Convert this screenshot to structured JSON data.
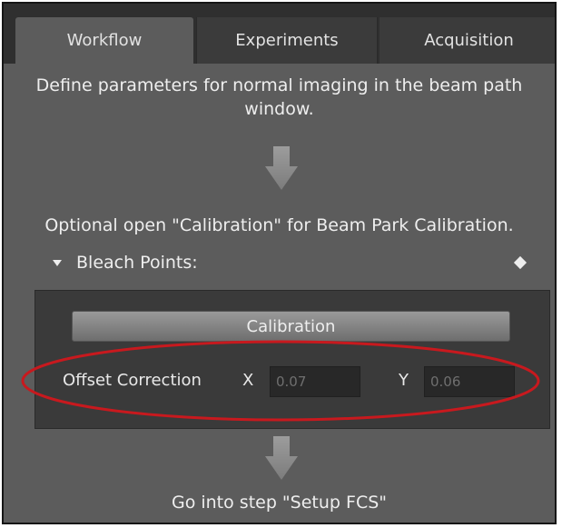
{
  "tabs": [
    {
      "label": "Workflow",
      "active": true
    },
    {
      "label": "Experiments",
      "active": false
    },
    {
      "label": "Acquisition",
      "active": false
    }
  ],
  "instructions": {
    "line1": "Define parameters for normal imaging in the beam path",
    "line2": "window.",
    "line3": "Optional open \"Calibration\" for Beam Park Calibration.",
    "line4": "Go into step \"Setup FCS\""
  },
  "bleach_points": {
    "label": "Bleach Points:",
    "expanded": true
  },
  "calibration_button": "Calibration",
  "offset_correction": {
    "label": "Offset Correction",
    "x_label": "X",
    "x_value": "0.07",
    "y_label": "Y",
    "y_value": "0.06"
  },
  "colors": {
    "panel_bg": "#5c5c5c",
    "tab_bar_bg": "#2f2f2f",
    "highlight_ellipse": "#c8191e"
  },
  "icons": [
    "down-arrow-icon",
    "expand-triangle-icon",
    "options-diamond-icon"
  ]
}
